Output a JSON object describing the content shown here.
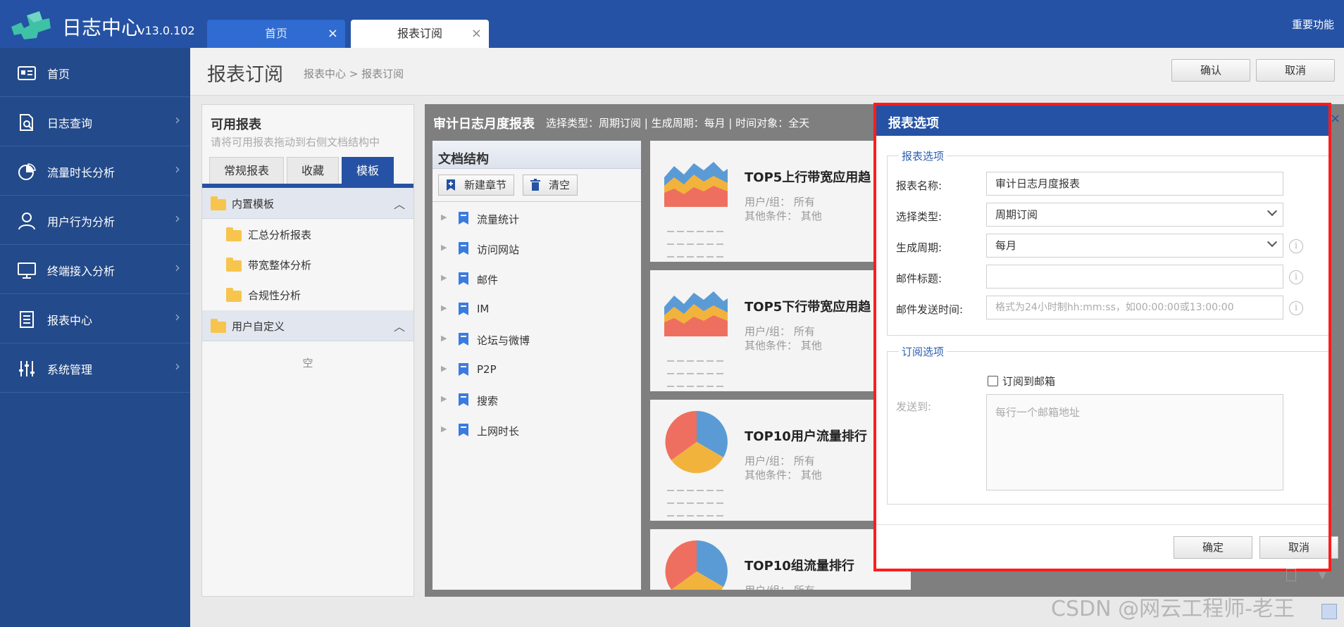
{
  "app": {
    "title": "日志中心",
    "version": "v13.0.102",
    "important": "重要功能"
  },
  "tabs": [
    {
      "label": "首页"
    },
    {
      "label": "报表订阅"
    }
  ],
  "sidebar": {
    "items": [
      {
        "label": "首页",
        "icon": "id-card-icon"
      },
      {
        "label": "日志查询",
        "icon": "document-search-icon"
      },
      {
        "label": "流量时长分析",
        "icon": "pie-chart-icon"
      },
      {
        "label": "用户行为分析",
        "icon": "user-icon"
      },
      {
        "label": "终端接入分析",
        "icon": "monitor-icon"
      },
      {
        "label": "报表中心",
        "icon": "report-icon"
      },
      {
        "label": "系统管理",
        "icon": "sliders-icon"
      }
    ]
  },
  "header": {
    "title": "报表订阅",
    "breadcrumb": "报表中心 > 报表订阅",
    "confirm": "确认",
    "cancel": "取消"
  },
  "available": {
    "title": "可用报表",
    "subtitle": "请将可用报表拖动到右侧文档结构中",
    "tabs": [
      "常规报表",
      "收藏",
      "模板"
    ],
    "groups": [
      {
        "label": "内置模板",
        "items": [
          "汇总分析报表",
          "带宽整体分析",
          "合规性分析"
        ]
      },
      {
        "label": "用户自定义",
        "items": []
      }
    ],
    "empty": "空"
  },
  "report": {
    "name": "审计日志月度报表",
    "meta": "选择类型：周期订阅    |    生成周期：每月    |    时间对象：全天"
  },
  "doc": {
    "title": "文档结构",
    "new_chapter": "新建章节",
    "clear": "清空",
    "items": [
      "流量统计",
      "访问网站",
      "邮件",
      "IM",
      "论坛与微博",
      "P2P",
      "搜索",
      "上网时长"
    ]
  },
  "cards": [
    {
      "title": "TOP5上行带宽应用趋",
      "user": "用户/组：  所有",
      "other": "其他条件：  其他",
      "thumb": "area"
    },
    {
      "title": "TOP5下行带宽应用趋",
      "user": "用户/组：  所有",
      "other": "其他条件：  其他",
      "thumb": "area"
    },
    {
      "title": "TOP10用户流量排行",
      "user": "用户/组：  所有",
      "other": "其他条件：  其他",
      "thumb": "pie"
    },
    {
      "title": "TOP10组流量排行",
      "user": "用户/组：  所有",
      "other": "",
      "thumb": "pie"
    }
  ],
  "dialog": {
    "title": "报表选项",
    "section1": "报表选项",
    "section2": "订阅选项",
    "fields": {
      "name_label": "报表名称:",
      "name_value": "审计日志月度报表",
      "type_label": "选择类型:",
      "type_value": "周期订阅",
      "period_label": "生成周期:",
      "period_value": "每月",
      "subject_label": "邮件标题:",
      "subject_value": "",
      "time_label": "邮件发送时间:",
      "time_placeholder": "格式为24小时制hh:mm:ss，如00:00:00或13:00:00"
    },
    "subscribe_label": "订阅到邮箱",
    "subscribe_checked": false,
    "sendto_label": "发送到:",
    "email_placeholder": "每行一个邮箱地址",
    "ok": "确定",
    "cancel": "取消"
  },
  "watermark": "CSDN @网云工程师-老王",
  "colors": {
    "primary": "#2552a4",
    "sidebar": "#234a8a",
    "highlight": "#ff1c1c",
    "area_red": "#ee6f5f",
    "area_yellow": "#f2b33d",
    "area_blue": "#5b9bd5"
  }
}
